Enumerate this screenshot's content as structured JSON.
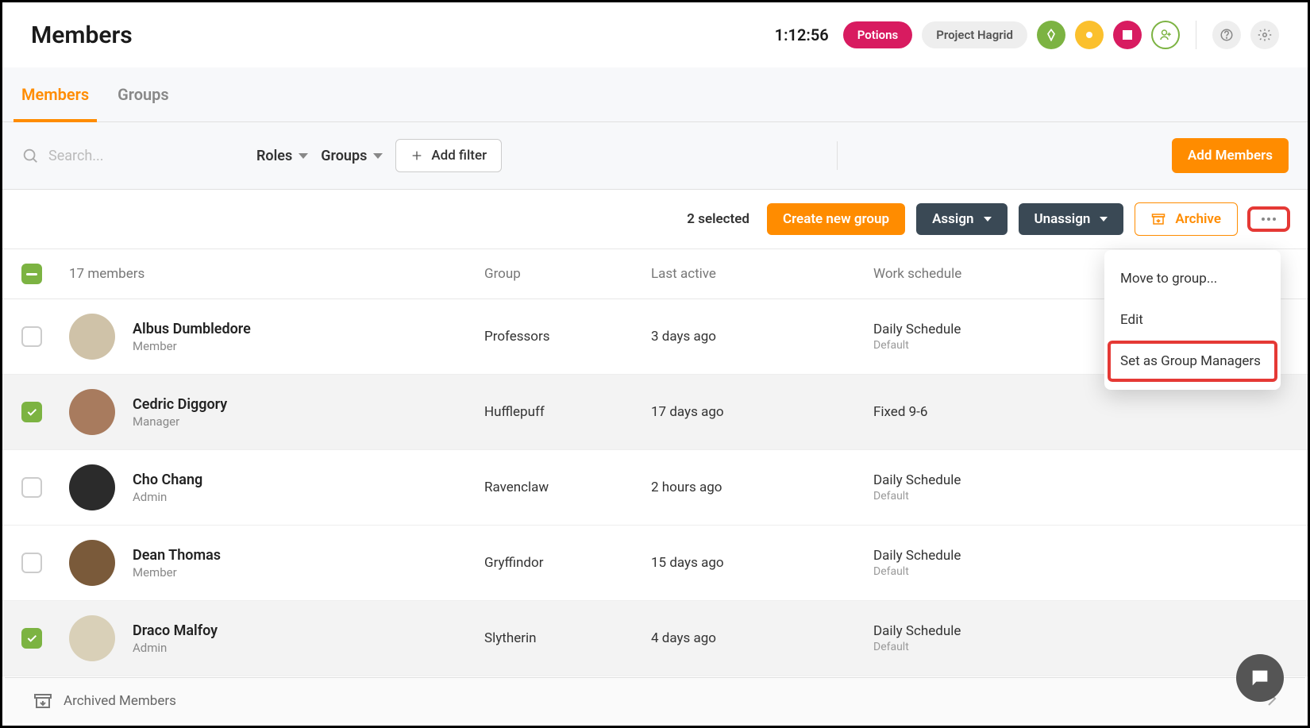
{
  "header": {
    "title": "Members",
    "timer": "1:12:56",
    "chip_primary": "Potions",
    "chip_secondary": "Project Hagrid"
  },
  "tabs": {
    "members": "Members",
    "groups": "Groups"
  },
  "toolbar": {
    "search_placeholder": "Search...",
    "roles_label": "Roles",
    "groups_label": "Groups",
    "add_filter": "Add filter",
    "add_members": "Add Members"
  },
  "action_bar": {
    "selected_text": "2 selected",
    "create_group": "Create new group",
    "assign": "Assign",
    "unassign": "Unassign",
    "archive": "Archive"
  },
  "table": {
    "count_label": "17 members",
    "headers": {
      "group": "Group",
      "last_active": "Last active",
      "work_schedule": "Work schedule"
    },
    "rows": [
      {
        "name": "Albus Dumbledore",
        "role": "Member",
        "group": "Professors",
        "last_active": "3 days ago",
        "schedule": "Daily Schedule",
        "schedule_sub": "Default",
        "selected": false,
        "avatar_bg": "#cfc2a8"
      },
      {
        "name": "Cedric Diggory",
        "role": "Manager",
        "group": "Hufflepuff",
        "last_active": "17 days ago",
        "schedule": "Fixed 9-6",
        "schedule_sub": "",
        "selected": true,
        "avatar_bg": "#a87b5e"
      },
      {
        "name": "Cho Chang",
        "role": "Admin",
        "group": "Ravenclaw",
        "last_active": "2 hours ago",
        "schedule": "Daily Schedule",
        "schedule_sub": "Default",
        "selected": false,
        "avatar_bg": "#2b2b2b"
      },
      {
        "name": "Dean Thomas",
        "role": "Member",
        "group": "Gryffindor",
        "last_active": "15 days ago",
        "schedule": "Daily Schedule",
        "schedule_sub": "Default",
        "selected": false,
        "avatar_bg": "#7a5a3a"
      },
      {
        "name": "Draco Malfoy",
        "role": "Admin",
        "group": "Slytherin",
        "last_active": "4 days ago",
        "schedule": "Daily Schedule",
        "schedule_sub": "Default",
        "selected": true,
        "avatar_bg": "#d9d0b8"
      }
    ]
  },
  "dropdown": {
    "move": "Move to group...",
    "edit": "Edit",
    "set_managers": "Set as Group Managers"
  },
  "footer": {
    "archived": "Archived Members"
  }
}
